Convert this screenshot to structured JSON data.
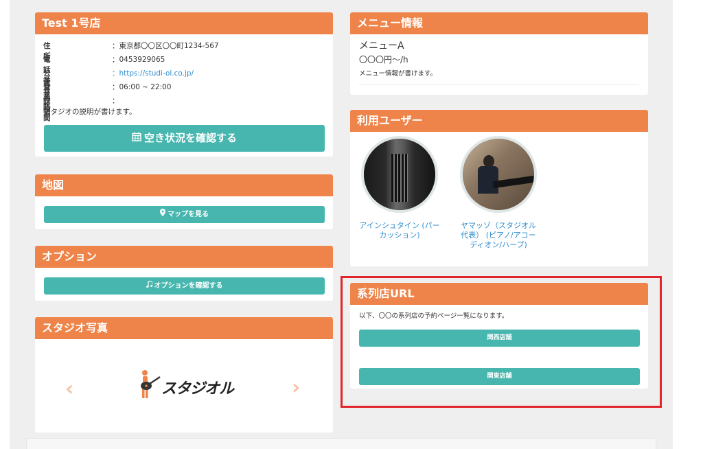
{
  "store": {
    "title": "Test 1号店",
    "rows": [
      {
        "label": "住所",
        "value": "：東京都〇〇区〇〇町1234-567"
      },
      {
        "label": "電話番号",
        "value": "：0453929065"
      },
      {
        "label": "公式サイト",
        "value": "：https://studi-ol.co.jp/"
      },
      {
        "label": "営業時間",
        "value": "：06:00 ~ 22:00"
      },
      {
        "label": "説明",
        "value": "："
      }
    ],
    "description": "スタジオの説明が書けます。",
    "availability_button": "空き状況を確認する"
  },
  "map": {
    "title": "地図",
    "button": "マップを見る"
  },
  "option": {
    "title": "オプション",
    "button": "オプションを確認する"
  },
  "photos": {
    "title": "スタジオ写真",
    "logo_text": "スタジオル",
    "prev": "‹",
    "next": "›"
  },
  "menu": {
    "title": "メニュー情報",
    "name": "メニューA",
    "price": "〇〇〇円～/h",
    "desc": "メニュー情報が書けます。"
  },
  "users": {
    "title": "利用ユーザー",
    "items": [
      {
        "name": "アインシュタイン (パーカッション)"
      },
      {
        "name": "ヤマッゾ（スタジオル代表） (ピアノ/アコーディオン/ハープ)"
      }
    ]
  },
  "affiliates": {
    "title": "系列店URL",
    "desc": "以下、〇〇の系列店の予約ページ一覧になります。",
    "buttons": [
      "関西店舗",
      "関東店舗"
    ]
  },
  "colors": {
    "header": "#ee8449",
    "button": "#46b6ae",
    "link": "#2f8ed0",
    "highlight": "#e0262a"
  },
  "icons": {
    "calendar": "calendar-icon",
    "map_pin": "map-pin-icon",
    "music": "music-note-icon"
  }
}
